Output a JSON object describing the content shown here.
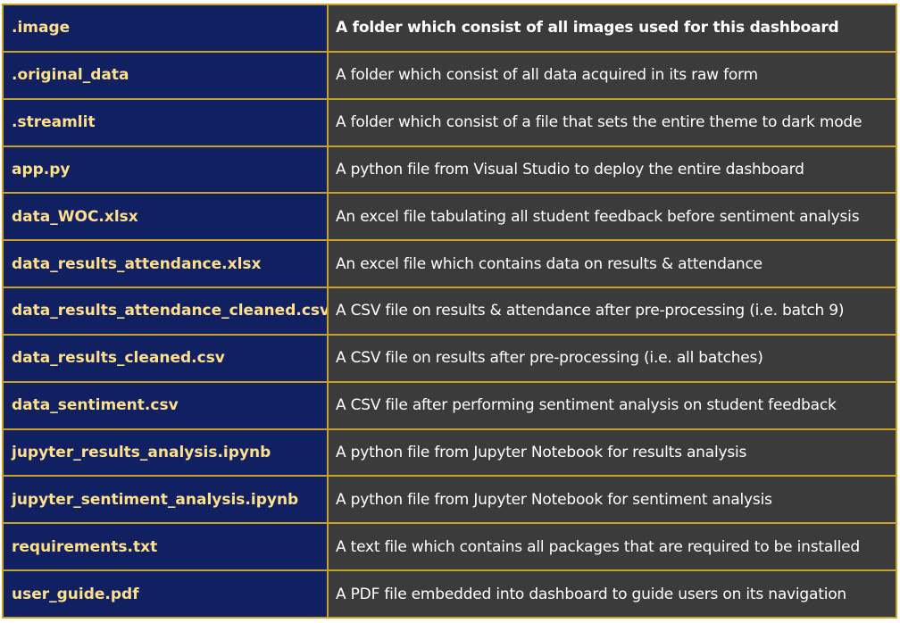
{
  "rows": [
    {
      "name": ".image",
      "desc": "A folder which consist of all images used for this dashboard"
    },
    {
      "name": ".original_data",
      "desc": "A folder which consist of all data acquired in its raw form"
    },
    {
      "name": ".streamlit",
      "desc": "A folder which consist of a file that sets the entire theme to dark mode"
    },
    {
      "name": "app.py",
      "desc": "A python file from Visual Studio  to deploy the entire dashboard"
    },
    {
      "name": "data_WOC.xlsx",
      "desc": "An excel file tabulating all student feedback before sentiment analysis"
    },
    {
      "name": "data_results_attendance.xlsx",
      "desc": "An excel file which contains data on results & attendance"
    },
    {
      "name": "data_results_attendance_cleaned.csv",
      "desc": "A CSV file on results & attendance after pre-processing (i.e. batch 9)"
    },
    {
      "name": "data_results_cleaned.csv",
      "desc": "A CSV file on results after pre-processing (i.e. all batches)"
    },
    {
      "name": "data_sentiment.csv",
      "desc": "A CSV file after performing sentiment analysis on student feedback"
    },
    {
      "name": "jupyter_results_analysis.ipynb",
      "desc": "A python file from Jupyter Notebook for results analysis"
    },
    {
      "name": "jupyter_sentiment_analysis.ipynb",
      "desc": "A python file from Jupyter Notebook for sentiment analysis"
    },
    {
      "name": "requirements.txt",
      "desc": "A text file which contains all packages that are required to be installed"
    },
    {
      "name": "user_guide.pdf",
      "desc": "A PDF file embedded into dashboard to guide users on its navigation"
    }
  ],
  "colors": {
    "name_bg": "#102060",
    "name_text": "#ffe08a",
    "desc_bg": "#3b3b3b",
    "desc_text": "#ffffff",
    "border": "#c8a02a"
  }
}
